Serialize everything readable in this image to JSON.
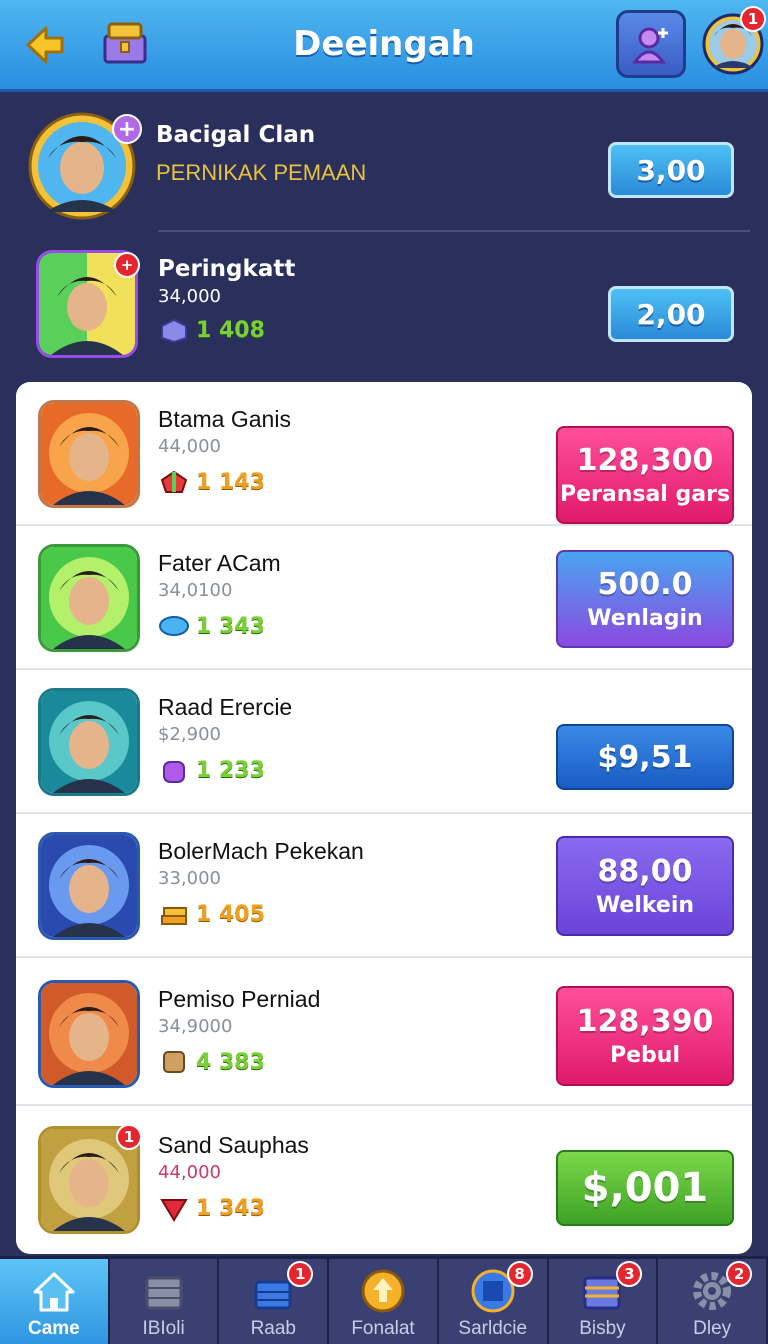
{
  "header": {
    "title": "Deeingah",
    "profile_badge": "1"
  },
  "top_rows": [
    {
      "name": "Bacigal Clan",
      "sub": "PERNIKAK PEMAAN",
      "button": "3,00"
    },
    {
      "name": "Peringkatt",
      "sub": "34,000",
      "stat": "1 408",
      "button": "2,00"
    }
  ],
  "list": [
    {
      "name": "Btama Ganis",
      "sub": "44,000",
      "stat": "1 143",
      "stat_color": "orange",
      "value": "128,300",
      "label": "Peransal gars",
      "button_style": "pink"
    },
    {
      "name": "Fater ACam",
      "sub": "34,0100",
      "stat": "1 343",
      "stat_color": "green",
      "value": "500.0",
      "label": "Wenlagin",
      "button_style": "purple"
    },
    {
      "name": "Raad Erercie",
      "sub": "$2,900",
      "stat": "1 233",
      "stat_color": "green",
      "value": "$9,51",
      "label": "",
      "button_style": "blue"
    },
    {
      "name": "BolerMach Pekekan",
      "sub": "33,000",
      "stat": "1 405",
      "stat_color": "orange",
      "value": "88,00",
      "label": "Welkein",
      "button_style": "violet"
    },
    {
      "name": "Pemiso Perniad",
      "sub": "34,9000",
      "stat": "4 383",
      "stat_color": "green",
      "value": "128,390",
      "label": "Pebul",
      "button_style": "pink"
    },
    {
      "name": "Sand Sauphas",
      "sub": "44,000",
      "stat": "1 343",
      "stat_color": "orange",
      "value": "$,001",
      "label": "",
      "button_style": "green",
      "avatar_badge": "1"
    }
  ],
  "nav": [
    {
      "label": "Came",
      "badge": ""
    },
    {
      "label": "IBIoli",
      "badge": ""
    },
    {
      "label": "Raab",
      "badge": "1"
    },
    {
      "label": "Fonalat",
      "badge": ""
    },
    {
      "label": "Sarldcie",
      "badge": "8"
    },
    {
      "label": "Bisby",
      "badge": "3"
    },
    {
      "label": "Dley",
      "badge": "2"
    }
  ],
  "icons": {
    "back": "arrow-left-icon",
    "shop": "treasure-chest-icon",
    "add_friend": "add-friend-icon",
    "home": "home-icon"
  },
  "colors": {
    "topbar": "#2a8ee0",
    "background": "#2a2f5c",
    "accent_pink": "#e01a6a",
    "accent_green": "#3ea226"
  }
}
